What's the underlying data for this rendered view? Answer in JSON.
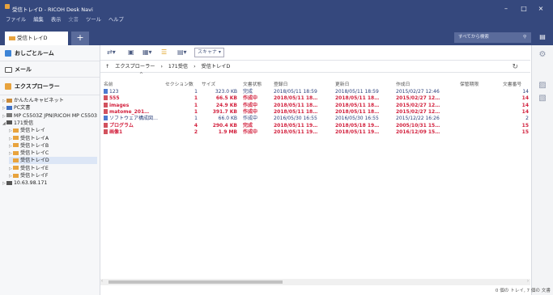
{
  "app": {
    "title": "受信トレイD - RICOH Desk Navi",
    "menu": [
      "ファイル",
      "編集",
      "表示",
      "文書",
      "ツール",
      "ヘルプ"
    ],
    "window_buttons": [
      "–",
      "□",
      "×"
    ]
  },
  "tabs": {
    "active_label": "受信トレイD",
    "add_label": "+",
    "search_placeholder": "すべてから検索"
  },
  "leftnav": {
    "favorites_label": "おしごとルーム",
    "mail_label": "メール",
    "explorer_label": "エクスプローラー",
    "tree": [
      {
        "label": "かんたんキャビネット",
        "level": 0,
        "expander": "▷",
        "icon": "cabinet-icon",
        "selected": false
      },
      {
        "label": "PC文書",
        "level": 0,
        "expander": "▷",
        "icon": "pc-icon",
        "selected": false
      },
      {
        "label": "MP C5503Z JPN(RICOH MP C5503Z JPN)",
        "level": 0,
        "expander": "▷",
        "icon": "printer-icon",
        "selected": false
      },
      {
        "label": "171受信",
        "level": 0,
        "expander": "◢",
        "icon": "server-icon",
        "selected": false
      },
      {
        "label": "受信トレイ",
        "level": 1,
        "expander": "▷",
        "icon": "tray-icon",
        "selected": false
      },
      {
        "label": "受信トレイA",
        "level": 1,
        "expander": "▷",
        "icon": "tray-icon",
        "selected": false
      },
      {
        "label": "受信トレイB",
        "level": 1,
        "expander": "▷",
        "icon": "tray-icon",
        "selected": false
      },
      {
        "label": "受信トレイC",
        "level": 1,
        "expander": "▷",
        "icon": "tray-icon",
        "selected": false
      },
      {
        "label": "受信トレイD",
        "level": 1,
        "expander": "",
        "icon": "tray-icon",
        "selected": true
      },
      {
        "label": "受信トレイE",
        "level": 1,
        "expander": "▷",
        "icon": "tray-icon",
        "selected": false
      },
      {
        "label": "受信トレイF",
        "level": 1,
        "expander": "▷",
        "icon": "tray-icon",
        "selected": false
      },
      {
        "label": "10.63.98.171",
        "level": 0,
        "expander": "▷",
        "icon": "server-icon",
        "selected": false
      }
    ]
  },
  "toolbar": {
    "scanner_label": "スキャナ"
  },
  "breadcrumb": {
    "up": "↑",
    "items": [
      "エクスプローラー",
      "›",
      "171受信",
      "›",
      "受信トレイD"
    ],
    "refresh": "↻"
  },
  "table": {
    "sort_indicator": "^",
    "columns": [
      "名前",
      "セクション数",
      "サイズ",
      "文書状態",
      "登録日",
      "更新日",
      "作成日",
      "保管期限",
      "文書番号"
    ],
    "rows": [
      {
        "name": "123",
        "sections": "1",
        "size": "323.0 KB",
        "status": "完成",
        "registered": "2018/05/11 18:59",
        "updated": "2018/05/11 18:59",
        "created": "2015/02/27 12:46",
        "expiry": "",
        "docno": "14",
        "highlight": false
      },
      {
        "name": "555",
        "sections": "1",
        "size": "66.5 KB",
        "status": "作成中",
        "registered": "2018/05/11 18…",
        "updated": "2018/05/11 18…",
        "created": "2015/02/27 12…",
        "expiry": "",
        "docno": "14",
        "highlight": true
      },
      {
        "name": "images",
        "sections": "1",
        "size": "24.9 KB",
        "status": "作成中",
        "registered": "2018/05/11 18…",
        "updated": "2018/05/11 18…",
        "created": "2015/02/27 12…",
        "expiry": "",
        "docno": "14",
        "highlight": true
      },
      {
        "name": "matome_201…",
        "sections": "1",
        "size": "391.7 KB",
        "status": "作成中",
        "registered": "2018/05/11 18…",
        "updated": "2018/05/11 18…",
        "created": "2015/02/27 12…",
        "expiry": "",
        "docno": "14",
        "highlight": true
      },
      {
        "name": "ソフトウェア構成図…",
        "sections": "1",
        "size": "66.0 KB",
        "status": "作成中",
        "registered": "2016/05/30 16:55",
        "updated": "2016/05/30 16:55",
        "created": "2015/12/22 16:26",
        "expiry": "",
        "docno": "2",
        "highlight": false
      },
      {
        "name": "プログラム",
        "sections": "4",
        "size": "290.4 KB",
        "status": "完成",
        "registered": "2018/05/11 19…",
        "updated": "2018/05/18 19…",
        "created": "2005/10/31 15…",
        "expiry": "",
        "docno": "15",
        "highlight": true
      },
      {
        "name": "画像1",
        "sections": "2",
        "size": "1.9 MB",
        "status": "作成中",
        "registered": "2018/05/11 19…",
        "updated": "2018/05/11 19…",
        "created": "2016/12/09 15…",
        "expiry": "",
        "docno": "15",
        "highlight": true
      }
    ]
  },
  "status": {
    "text": "0 個の トレイ, 7 個の 文書"
  },
  "colors": {
    "titlebar": "#35487d",
    "highlight_text": "#d21f3c",
    "normal_text": "#2a3f7a"
  }
}
